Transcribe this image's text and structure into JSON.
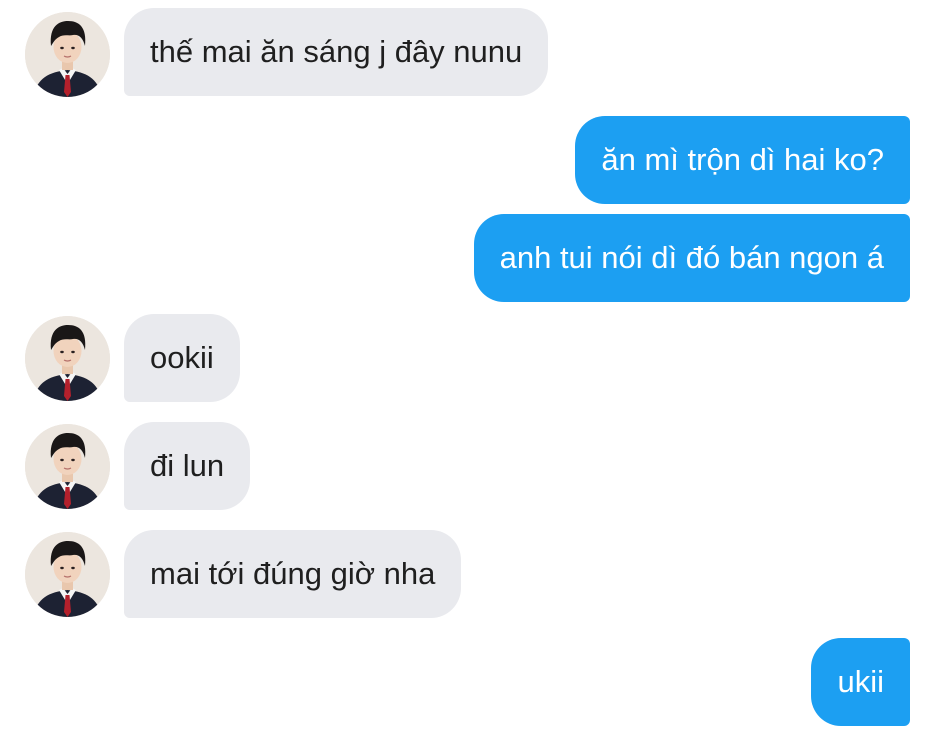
{
  "messages": [
    {
      "sender": "other",
      "text": "thế mai ăn sáng j đây nunu"
    },
    {
      "sender": "me",
      "text": "ăn mì trộn dì hai ko?"
    },
    {
      "sender": "me",
      "text": "anh tui nói dì đó bán ngon á"
    },
    {
      "sender": "other",
      "text": "ookii"
    },
    {
      "sender": "other",
      "text": "đi lun"
    },
    {
      "sender": "other",
      "text": "mai tới đúng giờ nha"
    },
    {
      "sender": "me",
      "text": "ukii"
    }
  ],
  "colors": {
    "outgoing_bubble": "#1c9ff2",
    "incoming_bubble": "#e9eaee",
    "incoming_text": "#1f1f1f",
    "outgoing_text": "#ffffff"
  }
}
